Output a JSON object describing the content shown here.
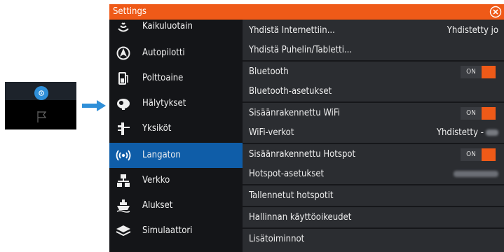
{
  "window": {
    "title": "Settings"
  },
  "menu": {
    "items": [
      {
        "label": "Kaikuluotain",
        "icon": "sonar-icon"
      },
      {
        "label": "Autopilotti",
        "icon": "autopilot-icon"
      },
      {
        "label": "Polttoaine",
        "icon": "fuel-icon"
      },
      {
        "label": "Hälytykset",
        "icon": "alarm-icon"
      },
      {
        "label": "Yksiköt",
        "icon": "units-icon"
      },
      {
        "label": "Langaton",
        "icon": "wireless-icon",
        "selected": true
      },
      {
        "label": "Verkko",
        "icon": "network-icon"
      },
      {
        "label": "Alukset",
        "icon": "vessels-icon"
      },
      {
        "label": "Simulaattori",
        "icon": "simulator-icon"
      }
    ]
  },
  "content": {
    "internet": {
      "label": "Yhdistä Internettiin...",
      "value": "Yhdistetty jo"
    },
    "phone": {
      "label": "Yhdistä Puhelin/Tabletti..."
    },
    "bluetooth": {
      "label": "Bluetooth",
      "toggle": "ON"
    },
    "bluetooth_settings": {
      "label": "Bluetooth-asetukset"
    },
    "wifi": {
      "label": "Sisäänrakennettu WiFi",
      "toggle": "ON"
    },
    "wifi_networks": {
      "label": "WiFi-verkot",
      "value": "Yhdistetty -"
    },
    "hotspot": {
      "label": "Sisäänrakennettu Hotspot",
      "toggle": "ON"
    },
    "hotspot_settings": {
      "label": "Hotspot-asetukset"
    },
    "saved_hotspots": {
      "label": "Tallennetut hotspotit"
    },
    "admin_rights": {
      "label": "Hallinnan käyttöoikeudet"
    },
    "more": {
      "label": "Lisätoiminnot"
    }
  },
  "colors": {
    "accent": "#ef5a18",
    "selected": "#0f5da8",
    "arrow": "#2f8fd8"
  }
}
